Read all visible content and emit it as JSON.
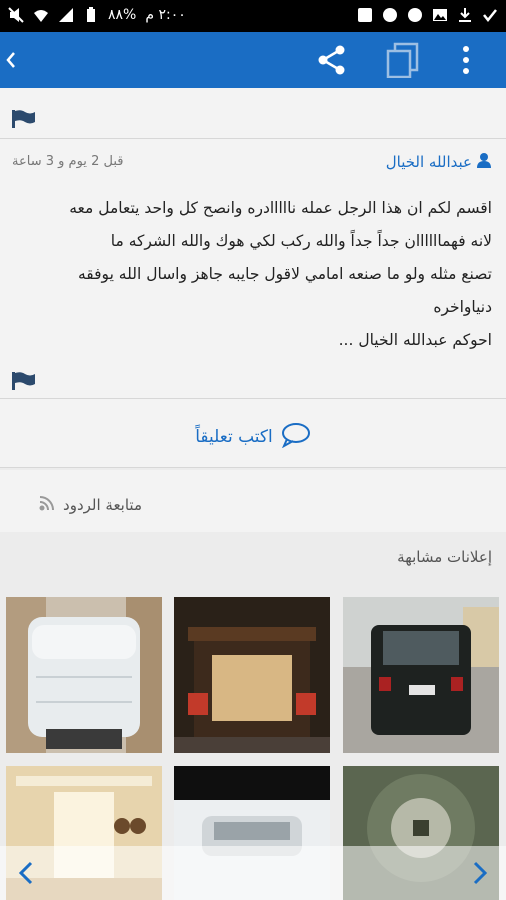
{
  "status_bar": {
    "time": "٢:٠٠ م",
    "battery": "%٨٨"
  },
  "post": {
    "author": "عبدالله الخيال",
    "time_ago": "قبل 2 يوم و 3 ساعة",
    "body_lines": [
      "اقسم لكم ان هذا الرجل عمله نااااادره وانصح كل واحد يتعامل معه",
      "لانه فهماااااان جداً جداً والله ركب لكي هوك والله الشركه ما",
      "تصنع مثله ولو ما صنعه امامي لاقول جايبه جاهز واسال الله يوفقه",
      "دنياواخره",
      "احوكم عبدالله الخيال ..."
    ]
  },
  "comment_button": "اكتب تعليقاً",
  "follow_label": "متابعة الردود",
  "similar_title": "إعلانات مشابهة",
  "colors": {
    "brand": "#1a6dc4",
    "background": "#ececec"
  }
}
